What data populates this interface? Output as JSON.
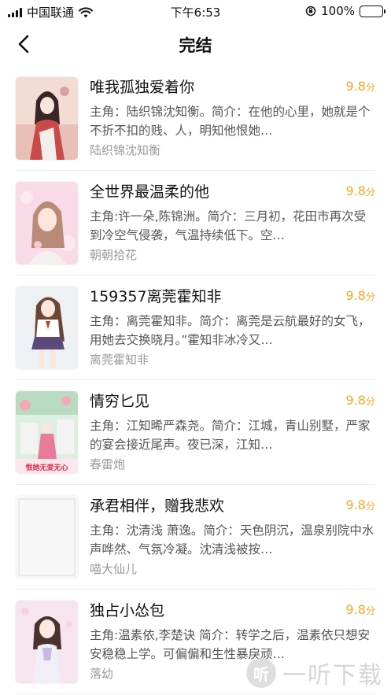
{
  "status_bar": {
    "carrier": "中国联通",
    "time": "下午6:53",
    "battery": "100%"
  },
  "nav": {
    "title": "完结",
    "back_icon": "chevron-left-icon"
  },
  "books": [
    {
      "title": "唯我孤独爱着你",
      "score": "9.8",
      "score_unit": "分",
      "desc": "主角：陆织锦沈知衡。简介：在他的心里，她就是个不折不扣的贱、人，明知他恨她…",
      "author": "陆织锦沈知衡"
    },
    {
      "title": "全世界最温柔的他",
      "score": "9.8",
      "score_unit": "分",
      "desc": "主角:许一朵,陈锦洲。简介：三月初，花田市再次受到冷空气侵袭，气温持续低下。空…",
      "author": "朝朝拾花"
    },
    {
      "title": "159357离莞霍知非",
      "score": "9.8",
      "score_unit": "分",
      "desc": "主角：离莞霍知非。简介：离莞是云航最好的女飞，用她去交换晓月。”霍知非冰冷又…",
      "author": "离莞霍知非"
    },
    {
      "title": "情穷匕见",
      "score": "9.8",
      "score_unit": "分",
      "desc": "主角：江知晞严森尧。简介：江城，青山别墅，严家的宴会接近尾声。夜已深，江知…",
      "author": "春雷炮",
      "cover_text": "恨她无爱无心"
    },
    {
      "title": "承君相伴，赠我悲欢",
      "score": "9.8",
      "score_unit": "分",
      "desc": "主角：沈清浅 萧逸。简介：天色阴沉，温泉别院中水声哗然、气氛冷凝。沈清浅被按…",
      "author": "喵大仙儿"
    },
    {
      "title": "独占小怂包",
      "score": "9.8",
      "score_unit": "分",
      "desc": "主角:温素依,李楚诀 简介：转学之后，温素依只想安安稳稳上学。可偏偏和生性暴戾顽…",
      "author": "落幼"
    }
  ],
  "watermark": {
    "logo": "听",
    "text": "一听下载"
  },
  "colors": {
    "score": "#f5a623",
    "title": "#111111",
    "desc": "#555555",
    "author": "#999999",
    "battery": "#4cd964"
  }
}
